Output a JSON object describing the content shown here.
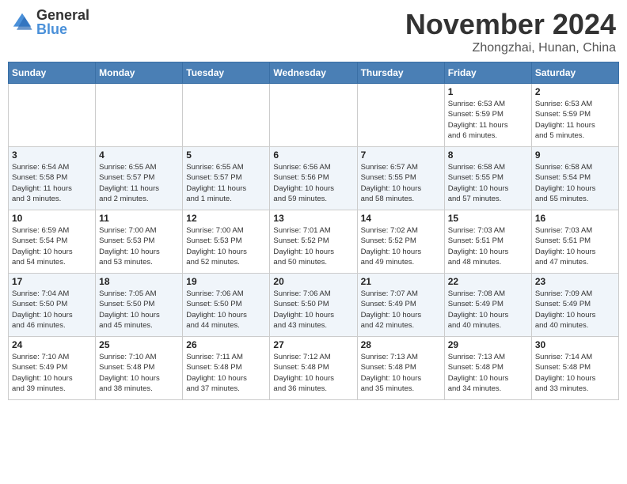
{
  "header": {
    "logo_general": "General",
    "logo_blue": "Blue",
    "month_title": "November 2024",
    "location": "Zhongzhai, Hunan, China"
  },
  "days_of_week": [
    "Sunday",
    "Monday",
    "Tuesday",
    "Wednesday",
    "Thursday",
    "Friday",
    "Saturday"
  ],
  "weeks": [
    [
      {
        "day": "",
        "info": ""
      },
      {
        "day": "",
        "info": ""
      },
      {
        "day": "",
        "info": ""
      },
      {
        "day": "",
        "info": ""
      },
      {
        "day": "",
        "info": ""
      },
      {
        "day": "1",
        "info": "Sunrise: 6:53 AM\nSunset: 5:59 PM\nDaylight: 11 hours\nand 6 minutes."
      },
      {
        "day": "2",
        "info": "Sunrise: 6:53 AM\nSunset: 5:59 PM\nDaylight: 11 hours\nand 5 minutes."
      }
    ],
    [
      {
        "day": "3",
        "info": "Sunrise: 6:54 AM\nSunset: 5:58 PM\nDaylight: 11 hours\nand 3 minutes."
      },
      {
        "day": "4",
        "info": "Sunrise: 6:55 AM\nSunset: 5:57 PM\nDaylight: 11 hours\nand 2 minutes."
      },
      {
        "day": "5",
        "info": "Sunrise: 6:55 AM\nSunset: 5:57 PM\nDaylight: 11 hours\nand 1 minute."
      },
      {
        "day": "6",
        "info": "Sunrise: 6:56 AM\nSunset: 5:56 PM\nDaylight: 10 hours\nand 59 minutes."
      },
      {
        "day": "7",
        "info": "Sunrise: 6:57 AM\nSunset: 5:55 PM\nDaylight: 10 hours\nand 58 minutes."
      },
      {
        "day": "8",
        "info": "Sunrise: 6:58 AM\nSunset: 5:55 PM\nDaylight: 10 hours\nand 57 minutes."
      },
      {
        "day": "9",
        "info": "Sunrise: 6:58 AM\nSunset: 5:54 PM\nDaylight: 10 hours\nand 55 minutes."
      }
    ],
    [
      {
        "day": "10",
        "info": "Sunrise: 6:59 AM\nSunset: 5:54 PM\nDaylight: 10 hours\nand 54 minutes."
      },
      {
        "day": "11",
        "info": "Sunrise: 7:00 AM\nSunset: 5:53 PM\nDaylight: 10 hours\nand 53 minutes."
      },
      {
        "day": "12",
        "info": "Sunrise: 7:00 AM\nSunset: 5:53 PM\nDaylight: 10 hours\nand 52 minutes."
      },
      {
        "day": "13",
        "info": "Sunrise: 7:01 AM\nSunset: 5:52 PM\nDaylight: 10 hours\nand 50 minutes."
      },
      {
        "day": "14",
        "info": "Sunrise: 7:02 AM\nSunset: 5:52 PM\nDaylight: 10 hours\nand 49 minutes."
      },
      {
        "day": "15",
        "info": "Sunrise: 7:03 AM\nSunset: 5:51 PM\nDaylight: 10 hours\nand 48 minutes."
      },
      {
        "day": "16",
        "info": "Sunrise: 7:03 AM\nSunset: 5:51 PM\nDaylight: 10 hours\nand 47 minutes."
      }
    ],
    [
      {
        "day": "17",
        "info": "Sunrise: 7:04 AM\nSunset: 5:50 PM\nDaylight: 10 hours\nand 46 minutes."
      },
      {
        "day": "18",
        "info": "Sunrise: 7:05 AM\nSunset: 5:50 PM\nDaylight: 10 hours\nand 45 minutes."
      },
      {
        "day": "19",
        "info": "Sunrise: 7:06 AM\nSunset: 5:50 PM\nDaylight: 10 hours\nand 44 minutes."
      },
      {
        "day": "20",
        "info": "Sunrise: 7:06 AM\nSunset: 5:50 PM\nDaylight: 10 hours\nand 43 minutes."
      },
      {
        "day": "21",
        "info": "Sunrise: 7:07 AM\nSunset: 5:49 PM\nDaylight: 10 hours\nand 42 minutes."
      },
      {
        "day": "22",
        "info": "Sunrise: 7:08 AM\nSunset: 5:49 PM\nDaylight: 10 hours\nand 40 minutes."
      },
      {
        "day": "23",
        "info": "Sunrise: 7:09 AM\nSunset: 5:49 PM\nDaylight: 10 hours\nand 40 minutes."
      }
    ],
    [
      {
        "day": "24",
        "info": "Sunrise: 7:10 AM\nSunset: 5:49 PM\nDaylight: 10 hours\nand 39 minutes."
      },
      {
        "day": "25",
        "info": "Sunrise: 7:10 AM\nSunset: 5:48 PM\nDaylight: 10 hours\nand 38 minutes."
      },
      {
        "day": "26",
        "info": "Sunrise: 7:11 AM\nSunset: 5:48 PM\nDaylight: 10 hours\nand 37 minutes."
      },
      {
        "day": "27",
        "info": "Sunrise: 7:12 AM\nSunset: 5:48 PM\nDaylight: 10 hours\nand 36 minutes."
      },
      {
        "day": "28",
        "info": "Sunrise: 7:13 AM\nSunset: 5:48 PM\nDaylight: 10 hours\nand 35 minutes."
      },
      {
        "day": "29",
        "info": "Sunrise: 7:13 AM\nSunset: 5:48 PM\nDaylight: 10 hours\nand 34 minutes."
      },
      {
        "day": "30",
        "info": "Sunrise: 7:14 AM\nSunset: 5:48 PM\nDaylight: 10 hours\nand 33 minutes."
      }
    ]
  ]
}
